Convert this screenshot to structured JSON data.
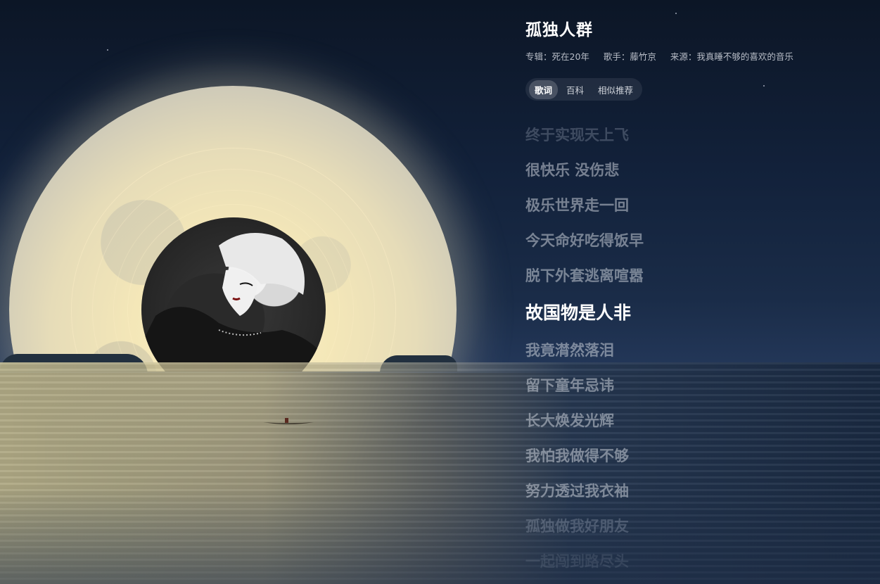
{
  "song": {
    "title": "孤独人群",
    "album": "专辑：死在20年",
    "artist": "歌手：藤竹京",
    "source": "来源：我真睡不够的喜欢的音乐"
  },
  "tabs": [
    {
      "label": "歌词",
      "active": true
    },
    {
      "label": "百科",
      "active": false
    },
    {
      "label": "相似推荐",
      "active": false
    }
  ],
  "lyrics": [
    "终于实现天上飞",
    "很快乐 没伤悲",
    "极乐世界走一回",
    "今天命好吃得饭早",
    "脱下外套逃离喧嚣",
    "故国物是人非",
    "我竟潸然落泪",
    "留下童年忌讳",
    "长大焕发光辉",
    "我怕我做得不够",
    "努力透过我衣袖",
    "孤独做我好朋友",
    "一起闯到路尽头"
  ],
  "current_lyric_index": 5,
  "colors": {
    "sky": "#0c1626",
    "moon": "#f4e7b8",
    "current_lyric": "#ffffff",
    "lyric": "#c8cdd7"
  }
}
